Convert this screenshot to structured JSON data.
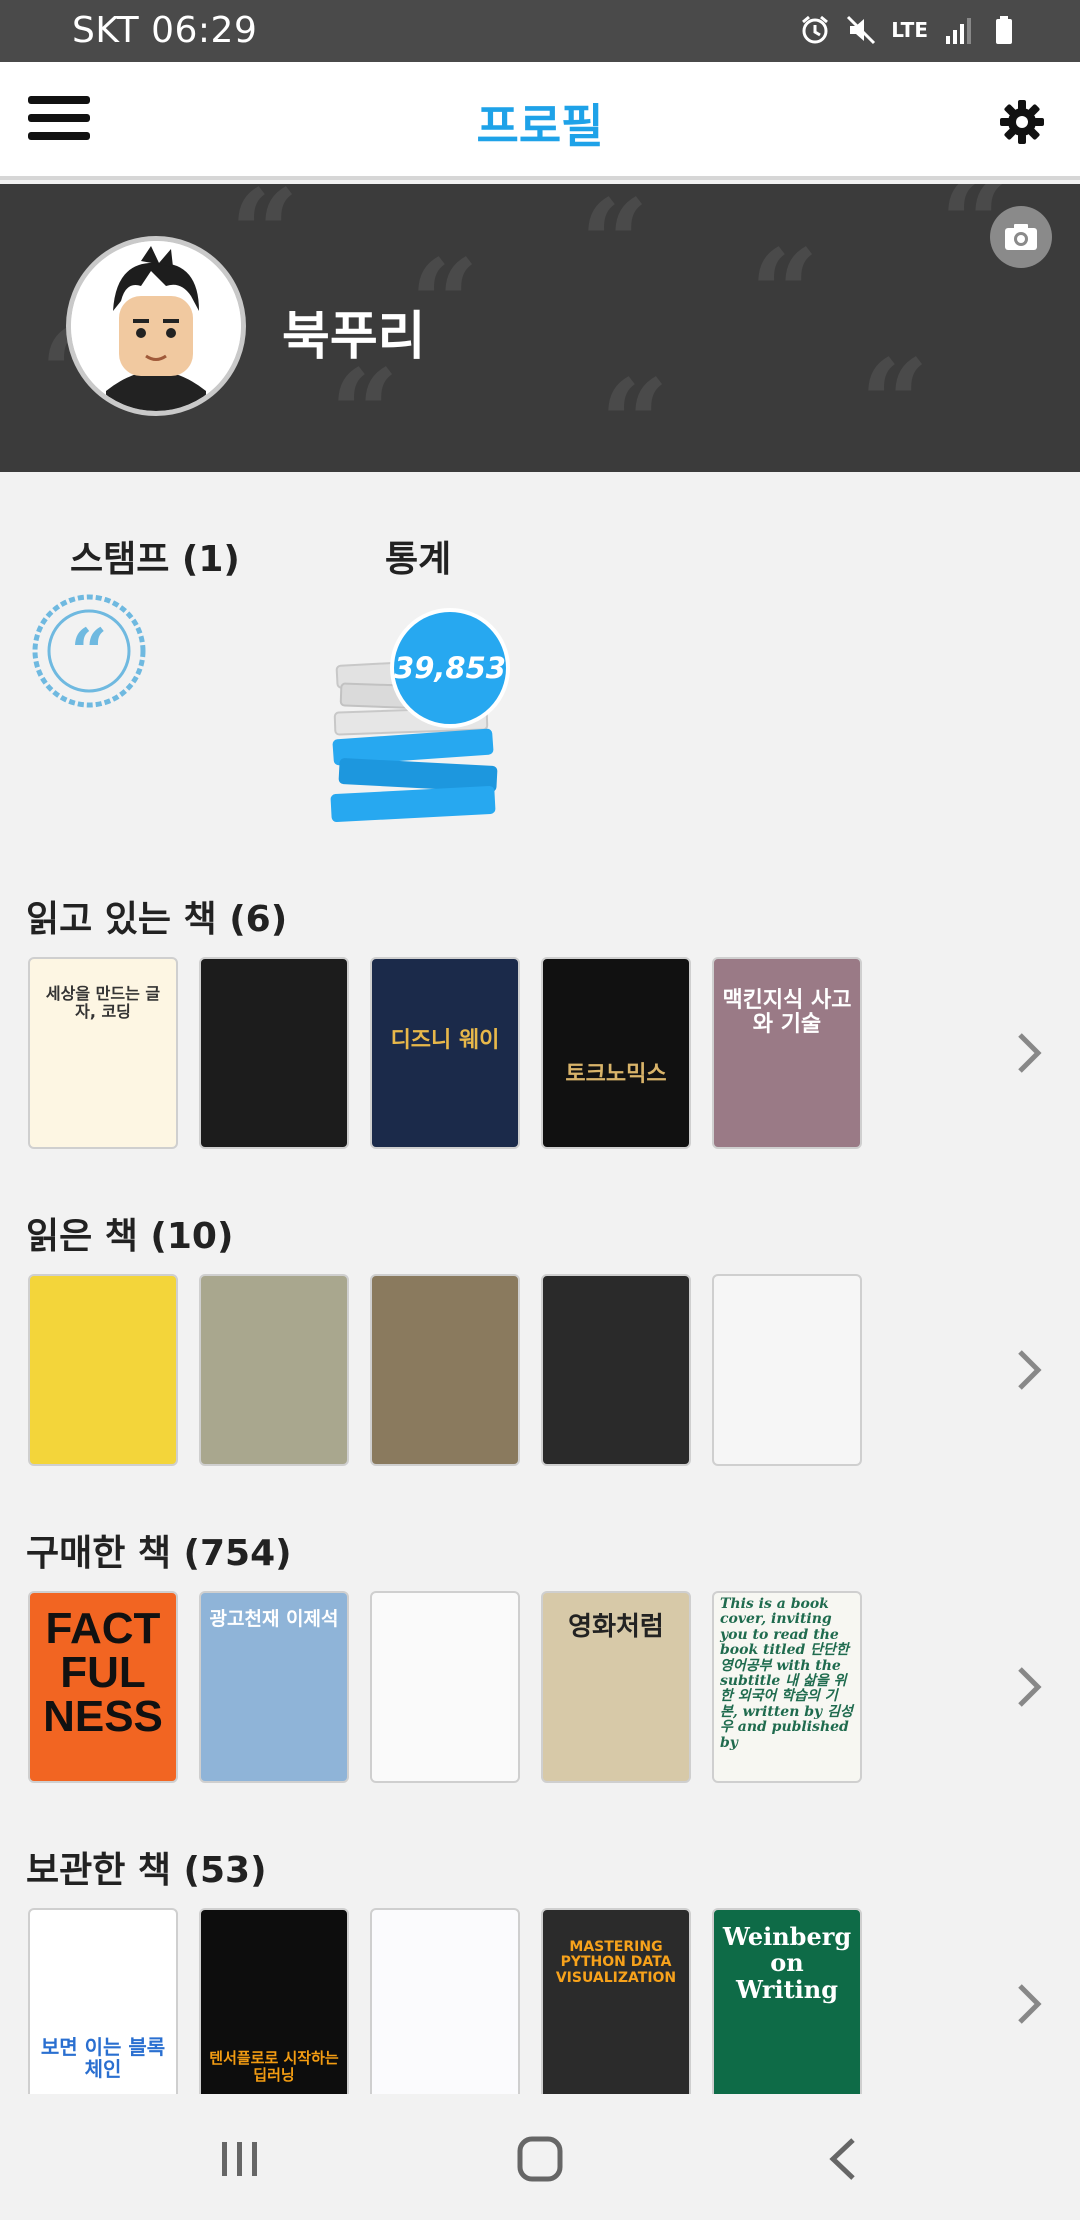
{
  "status_bar": {
    "carrier_time": "SKT 06:29",
    "icons": [
      "alarm-icon",
      "mute-icon",
      "lte-icon",
      "signal-icon",
      "battery-icon"
    ],
    "network_label": "LTE"
  },
  "app_bar": {
    "title": "프로필",
    "menu_icon": "hamburger-menu-icon",
    "settings_icon": "gear-icon"
  },
  "profile": {
    "username": "북푸리",
    "camera_icon": "camera-icon"
  },
  "stamps": {
    "label": "스탬프 (1)"
  },
  "stats": {
    "label": "통계",
    "count": "39,853"
  },
  "shelves": [
    {
      "title": "읽고 있는 책 (6)",
      "books": [
        {
          "title": "세상을 만드는 글자, 코딩",
          "color": "#fdf6e3",
          "text_color": "#333"
        },
        {
          "title": "",
          "color": "#1c1c1c",
          "text_color": "#f0c030"
        },
        {
          "title": "디즈니 웨이",
          "color": "#1b2a4a",
          "text_color": "#e8b84a"
        },
        {
          "title": "토크노믹스",
          "color": "#111111",
          "text_color": "#d9b46a"
        },
        {
          "title": "맥킨지식 사고와 기술",
          "color": "#9a7a86",
          "text_color": "#ffffff"
        }
      ]
    },
    {
      "title": "읽은 책 (10)",
      "books": [
        {
          "title": "",
          "color": "#f3d53a",
          "text_color": "#2a6e3a"
        },
        {
          "title": "",
          "color": "#a9a78e",
          "text_color": "#333"
        },
        {
          "title": "",
          "color": "#8a7a5e",
          "text_color": "#fff"
        },
        {
          "title": "",
          "color": "#2a2a2a",
          "text_color": "#ddd"
        },
        {
          "title": "",
          "color": "#f6f6f6",
          "text_color": "#222"
        }
      ]
    },
    {
      "title": "구매한 책 (754)",
      "books": [
        {
          "title": "FACT FUL NESS",
          "color": "#f26522",
          "text_color": "#111"
        },
        {
          "title": "광고천재 이제석",
          "color": "#8fb4d8",
          "text_color": "#fff"
        },
        {
          "title": "",
          "color": "#fafafa",
          "text_color": "#333"
        },
        {
          "title": "영화처럼",
          "color": "#d7c9a8",
          "text_color": "#222"
        },
        {
          "title": "This is a book cover, inviting you to read the book titled 단단한 영어공부 with the subtitle 내 삶을 위한 외국어 학습의 기본, written by 김성우 and published by",
          "color": "#f7f7f2",
          "text_color": "#1f6b4e"
        }
      ]
    },
    {
      "title": "보관한 책 (53)",
      "books": [
        {
          "title": "보면 이는 블록체인",
          "color": "#ffffff",
          "text_color": "#2a6fd0"
        },
        {
          "title": "텐서플로로 시작하는 딥러닝",
          "color": "#0d0d0d",
          "text_color": "#f39c12"
        },
        {
          "title": "",
          "color": "#fbfbfd",
          "text_color": "#333"
        },
        {
          "title": "MASTERING PYTHON DATA VISUALIZATION",
          "color": "#2b2b2b",
          "text_color": "#f7a21b"
        },
        {
          "title": "Weinberg on Writing",
          "color": "#0e6b47",
          "text_color": "#fff"
        }
      ]
    }
  ],
  "nav_bar": {
    "icons": [
      "recent-apps-icon",
      "home-icon",
      "back-icon"
    ]
  }
}
